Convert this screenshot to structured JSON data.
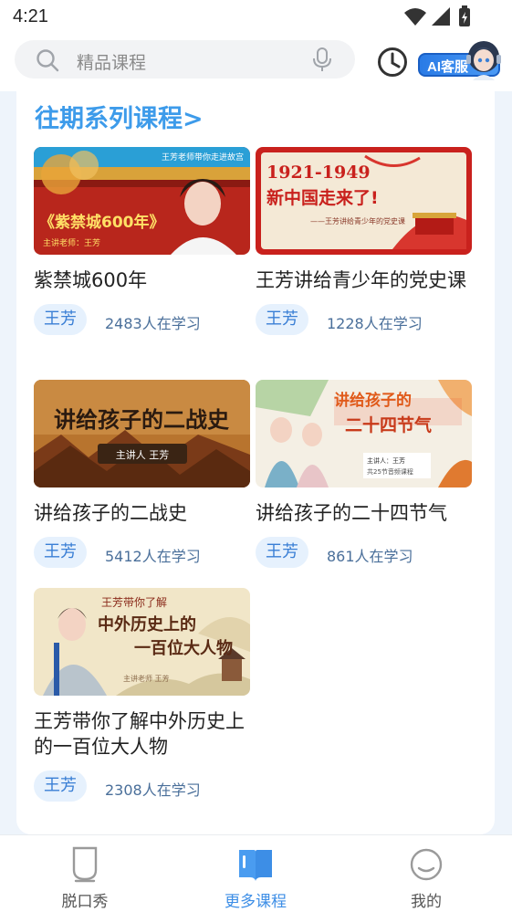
{
  "status_bar": {
    "time": "4:21"
  },
  "search": {
    "placeholder": "精品课程"
  },
  "ai_service": {
    "label": "AI客服"
  },
  "section": {
    "title": "往期系列课程>"
  },
  "courses": [
    {
      "title": "紫禁城600年",
      "teacher": "王芳",
      "learners": "2483人在学习",
      "thumb_text": {
        "top": "王芳老师带你走进故宫",
        "main": "《紫禁城600年》",
        "sub": "主讲老师：王芳"
      }
    },
    {
      "title": "王芳讲给青少年的党史课",
      "teacher": "王芳",
      "learners": "1228人在学习",
      "thumb_text": {
        "years": "1921-1949",
        "main": "新中国走来了!",
        "sub": "——王芳讲给青少年的党史课"
      }
    },
    {
      "title": "讲给孩子的二战史",
      "teacher": "王芳",
      "learners": "5412人在学习",
      "thumb_text": {
        "main": "讲给孩子的二战史",
        "sub": "主讲人 王芳"
      }
    },
    {
      "title": "讲给孩子的二十四节气",
      "teacher": "王芳",
      "learners": "861人在学习",
      "thumb_text": {
        "line1": "讲给孩子的",
        "line2": "二十四节气",
        "sub": "主讲人：王芳",
        "sub2": "共25节音频课程"
      }
    },
    {
      "title": "王芳带你了解中外历史上的一百位大人物",
      "teacher": "王芳",
      "learners": "2308人在学习",
      "thumb_text": {
        "line1": "王芳带你了解",
        "line2": "中外历史上的",
        "line3": "一百位大人物",
        "sub": "主讲老师 王芳"
      }
    }
  ],
  "bottom_nav": {
    "items": [
      {
        "label": "脱口秀",
        "icon": "talk-show-icon",
        "active": false
      },
      {
        "label": "更多课程",
        "icon": "book-icon",
        "active": true
      },
      {
        "label": "我的",
        "icon": "profile-face-icon",
        "active": false
      }
    ]
  },
  "colors": {
    "accent": "#3d9bea",
    "active_nav": "#3d8ee6",
    "tag_bg": "#e6f1fd",
    "tag_text": "#3a7fd5"
  }
}
